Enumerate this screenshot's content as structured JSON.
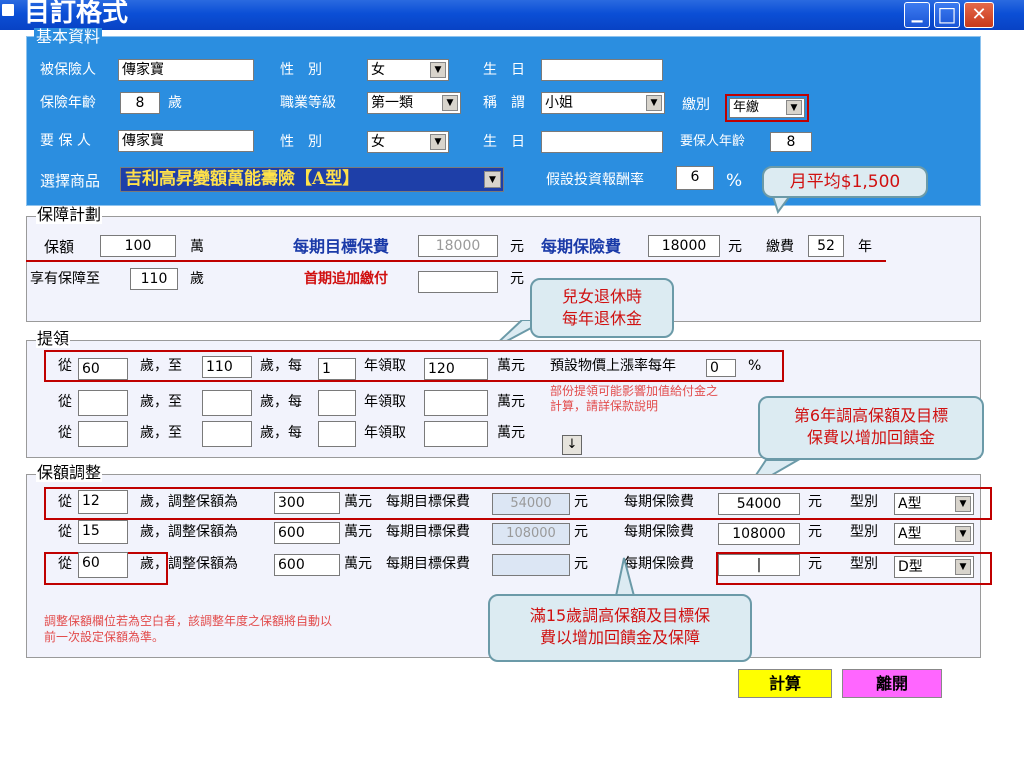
{
  "window": {
    "title": "目訂格式",
    "min": "▁",
    "max": "□",
    "close": "✕"
  },
  "basic": {
    "legend": "基本資料",
    "insured_label": "被保險人",
    "insured_name": "傳家寶",
    "gender_label": "性　別",
    "gender_value": "女",
    "birth_label": "生　日",
    "age_label": "保險年齡",
    "age_value": "8",
    "age_unit": "歲",
    "job_label": "職業等級",
    "job_value": "第一類",
    "title_label": "稱　謂",
    "title_value": "小姐",
    "payment_label": "繳別",
    "payment_value": "年繳",
    "applicant_label": "要 保 人",
    "applicant_name": "傳家寶",
    "gender2_label": "性　別",
    "gender2_value": "女",
    "birth2_label": "生　日",
    "applicant_age_label": "要保人年齡",
    "applicant_age_value": "8",
    "product_label": "選擇商品",
    "product_value": "吉利高昇變額萬能壽險【A型】",
    "roi_label": "假設投資報酬率",
    "roi_value": "6",
    "roi_unit": "%"
  },
  "callouts": {
    "monthly": "月平均$1,500",
    "retire_line1": "兒女退休時",
    "retire_line2": "每年退休金",
    "year6_line1": "第6年調高保額及目標",
    "year6_line2": "保費以增加回饋金",
    "age15_line1": "滿15歲調高保額及目標保",
    "age15_line2": "費以增加回饋金及保障"
  },
  "plan": {
    "legend": "保障計劃",
    "sum_label": "保額",
    "sum_value": "100",
    "sum_unit": "萬",
    "target_label": "每期目標保費",
    "target_value": "18000",
    "target_unit": "元",
    "premium_label": "每期保險費",
    "premium_value": "18000",
    "premium_unit": "元",
    "pay_label": "繳費",
    "pay_value": "52",
    "pay_unit": "年",
    "until_label": "享有保障至",
    "until_value": "110",
    "until_unit": "歲",
    "first_add_label": "首期追加繳付",
    "first_add_value": "",
    "first_add_unit": "元"
  },
  "withdraw": {
    "legend": "提領",
    "from": "從",
    "age_to": "歲，至",
    "age_every": "歲，每",
    "year_get": "年領取",
    "wan": "萬元",
    "rows": [
      {
        "from": "60",
        "to": "110",
        "every": "1",
        "amount": "120"
      },
      {
        "from": "",
        "to": "",
        "every": "",
        "amount": ""
      },
      {
        "from": "",
        "to": "",
        "every": "",
        "amount": ""
      }
    ],
    "inflation_label": "預設物價上漲率每年",
    "inflation_value": "0",
    "inflation_unit": "%",
    "note_line1": "部份提領可能影響加值給付金之",
    "note_line2": "計算，請詳保款說明",
    "down_icon": "↓"
  },
  "adjust": {
    "legend": "保額調整",
    "from": "從",
    "adj_label": "歲，調整保額為",
    "wan": "萬元",
    "target_label": "每期目標保費",
    "yuan": "元",
    "premium_label": "每期保險費",
    "type_label": "型別",
    "rows": [
      {
        "from": "12",
        "sum": "300",
        "target": "54000",
        "premium": "54000",
        "type": "A型"
      },
      {
        "from": "15",
        "sum": "600",
        "target": "108000",
        "premium": "108000",
        "type": "A型"
      },
      {
        "from": "60",
        "sum": "600",
        "target": "",
        "premium": "|",
        "type": "D型"
      }
    ],
    "note_line1": "調整保額欄位若為空白者，該調整年度之保額將自動以",
    "note_line2": "前一次設定保額為準。"
  },
  "buttons": {
    "calc": "計算",
    "exit": "離開"
  }
}
